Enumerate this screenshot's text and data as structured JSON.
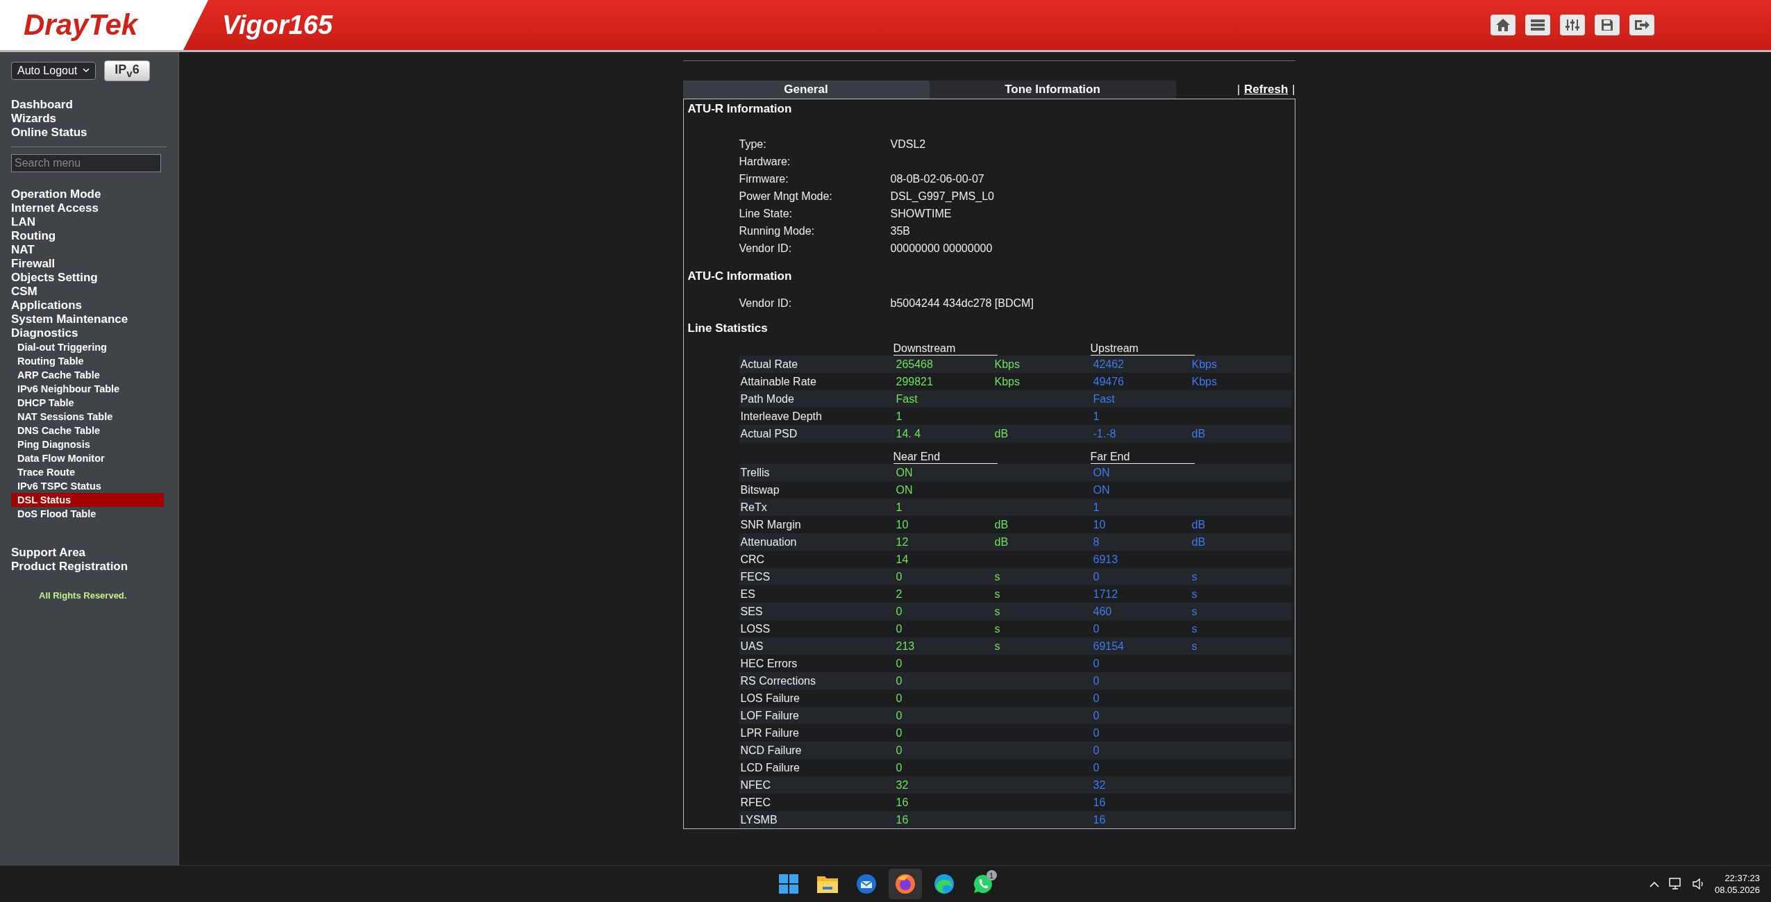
{
  "header": {
    "brand": "DrayTek",
    "model": "Vigor165",
    "tools": [
      {
        "kind": "home"
      },
      {
        "kind": "list"
      },
      {
        "kind": "sliders"
      },
      {
        "kind": "save"
      },
      {
        "kind": "logout"
      }
    ]
  },
  "sidebar": {
    "logout_select": "Auto Logout",
    "ipv6_button": "IP$_{v}$6",
    "top_links": [
      "Dashboard",
      "Wizards",
      "Online Status"
    ],
    "search": {
      "placeholder": "Search menu"
    },
    "menu": [
      {
        "label": "Operation Mode",
        "selected": false
      },
      {
        "label": "Internet Access",
        "selected": false
      },
      {
        "label": "LAN",
        "selected": false
      },
      {
        "label": "Routing",
        "selected": false
      },
      {
        "label": "NAT",
        "selected": false
      },
      {
        "label": "Firewall",
        "selected": false
      },
      {
        "label": "Objects Setting",
        "selected": false
      },
      {
        "label": "CSM",
        "selected": false
      },
      {
        "label": "Applications",
        "selected": false
      },
      {
        "label": "System Maintenance",
        "selected": false
      },
      {
        "label": "Diagnostics",
        "selected": false,
        "children": [
          {
            "label": "Dial-out Triggering",
            "selected": false
          },
          {
            "label": "Routing Table",
            "selected": false
          },
          {
            "label": "ARP Cache Table",
            "selected": false
          },
          {
            "label": "IPv6 Neighbour Table",
            "selected": false
          },
          {
            "label": "DHCP Table",
            "selected": false
          },
          {
            "label": "NAT Sessions Table",
            "selected": false
          },
          {
            "label": "DNS Cache Table",
            "selected": false
          },
          {
            "label": "Ping Diagnosis",
            "selected": false
          },
          {
            "label": "Data Flow Monitor",
            "selected": false
          },
          {
            "label": "Trace Route",
            "selected": false
          },
          {
            "label": "IPv6 TSPC Status",
            "selected": false
          },
          {
            "label": "DSL Status",
            "selected": true
          },
          {
            "label": "DoS Flood Table",
            "selected": false
          }
        ]
      }
    ],
    "bottom_links": [
      "Support Area",
      "Product Registration"
    ],
    "footer": "All Rights Reserved."
  },
  "main": {
    "tabs": [
      {
        "label": "General",
        "selected": true
      },
      {
        "label": "Tone Information",
        "selected": false
      }
    ],
    "refresh": {
      "label": "Refresh",
      "dividers": [
        "|",
        "|"
      ]
    },
    "atu_r": {
      "title": "ATU-R Information",
      "fields": [
        {
          "label": "Type:",
          "value": "VDSL2"
        },
        {
          "label": "Hardware:"
        },
        {
          "label": "Firmware:",
          "value": "08-0B-02-06-00-07"
        },
        {
          "label": "Power Mngt Mode:",
          "value": "DSL_G997_PMS_L0"
        },
        {
          "label": "Line State:",
          "value": "SHOWTIME"
        },
        {
          "label": "Running Mode:",
          "value": "35B"
        },
        {
          "label": "Vendor ID:",
          "value": "00000000 00000000"
        }
      ]
    },
    "atu_c": {
      "title": "ATU-C Information",
      "fields": [
        {
          "label": "Vendor ID:",
          "value": "b5004244 434dc278 [BDCM]"
        }
      ]
    },
    "line_statistics": {
      "title": "Line Statistics",
      "groups": [
        {
          "headers": [
            "Downstream",
            "Upstream"
          ],
          "rows": [
            {
              "label": "Actual Rate",
              "down": "265468",
              "down_unit": "Kbps",
              "up": "42462",
              "up_unit": "Kbps"
            },
            {
              "label": "Attainable Rate",
              "down": "299821",
              "down_unit": "Kbps",
              "up": "49476",
              "up_unit": "Kbps"
            },
            {
              "label": "Path Mode",
              "down": "Fast",
              "up": "Fast"
            },
            {
              "label": "Interleave Depth",
              "down": "1",
              "up": "1"
            },
            {
              "label": "Actual PSD",
              "down": "14. 4",
              "down_unit": "dB",
              "up": "-1.-8",
              "up_unit": "dB"
            }
          ]
        },
        {
          "headers": [
            "Near End",
            "Far End"
          ],
          "rows": [
            {
              "label": "Trellis",
              "down": "ON",
              "up": "ON"
            },
            {
              "label": "Bitswap",
              "down": "ON",
              "up": "ON"
            },
            {
              "label": "ReTx",
              "down": "1",
              "up": "1"
            },
            {
              "label": "SNR Margin",
              "down": "10",
              "down_unit": "dB",
              "up": "10",
              "up_unit": "dB"
            },
            {
              "label": "Attenuation",
              "down": "12",
              "down_unit": "dB",
              "up": "8",
              "up_unit": "dB"
            },
            {
              "label": "CRC",
              "down": "14",
              "up": "6913"
            },
            {
              "label": "FECS",
              "down": "0",
              "down_unit": "s",
              "up": "0",
              "up_unit": "s"
            },
            {
              "label": "ES",
              "down": "2",
              "down_unit": "s",
              "up": "1712",
              "up_unit": "s"
            },
            {
              "label": "SES",
              "down": "0",
              "down_unit": "s",
              "up": "460",
              "up_unit": "s"
            },
            {
              "label": "LOSS",
              "down": "0",
              "down_unit": "s",
              "up": "0",
              "up_unit": "s"
            },
            {
              "label": "UAS",
              "down": "213",
              "down_unit": "s",
              "up": "69154",
              "up_unit": "s"
            },
            {
              "label": "HEC Errors",
              "down": "0",
              "up": "0"
            },
            {
              "label": "RS Corrections",
              "down": "0",
              "up": "0"
            },
            {
              "label": "LOS Failure",
              "down": "0",
              "up": "0"
            },
            {
              "label": "LOF Failure",
              "down": "0",
              "up": "0"
            },
            {
              "label": "LPR Failure",
              "down": "0",
              "up": "0"
            },
            {
              "label": "NCD Failure",
              "down": "0",
              "up": "0"
            },
            {
              "label": "LCD Failure",
              "down": "0",
              "up": "0"
            },
            {
              "label": "NFEC",
              "down": "32",
              "up": "32"
            },
            {
              "label": "RFEC",
              "down": "16",
              "up": "16"
            },
            {
              "label": "LYSMB",
              "down": "16",
              "up": "16"
            }
          ]
        }
      ]
    }
  },
  "taskbar": {
    "apps": [
      {
        "kind": "start",
        "selected": false
      },
      {
        "kind": "folder",
        "selected": false
      },
      {
        "kind": "mail",
        "selected": false
      },
      {
        "kind": "browser_fox",
        "selected": true
      },
      {
        "kind": "browser_wave",
        "selected": false
      },
      {
        "kind": "chat",
        "selected": false,
        "badge": "1"
      }
    ],
    "time": "22:37:23",
    "date": "08.05.2026"
  }
}
